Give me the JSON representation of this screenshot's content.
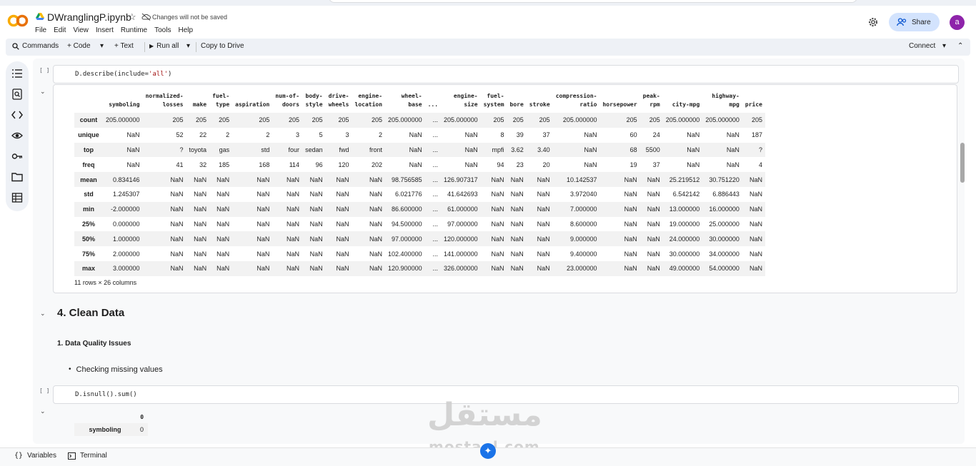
{
  "app": {
    "notebook_title": "DWranglingP.ipynb",
    "save_status": "Changes will not be saved",
    "menu": [
      "File",
      "Edit",
      "View",
      "Insert",
      "Runtime",
      "Tools",
      "Help"
    ],
    "share_label": "Share",
    "avatar_letter": "a",
    "accent_color": "#d3e3fd"
  },
  "toolbar": {
    "commands": "Commands",
    "code": "+ Code",
    "text": "+ Text",
    "run_all": "Run all",
    "copy_to_drive": "Copy to Drive",
    "connect": "Connect"
  },
  "cell1": {
    "bracket": "[ ]",
    "code_prefix": "D.describe(include=",
    "code_string": "'all'",
    "code_suffix": ")"
  },
  "describe_table": {
    "columns": [
      [
        "symboling"
      ],
      [
        "normalized-",
        "losses"
      ],
      [
        "make"
      ],
      [
        "fuel-",
        "type"
      ],
      [
        "aspiration"
      ],
      [
        "num-of-",
        "doors"
      ],
      [
        "body-",
        "style"
      ],
      [
        "drive-",
        "wheels"
      ],
      [
        "engine-",
        "location"
      ],
      [
        "wheel-",
        "base"
      ],
      [
        "..."
      ],
      [
        "engine-",
        "size"
      ],
      [
        "fuel-",
        "system"
      ],
      [
        "bore"
      ],
      [
        "stroke"
      ],
      [
        "compression-",
        "ratio"
      ],
      [
        "horsepower"
      ],
      [
        "peak-",
        "rpm"
      ],
      [
        "city-mpg"
      ],
      [
        "highway-",
        "mpg"
      ],
      [
        "price"
      ]
    ],
    "rows": [
      {
        "label": "count",
        "values": [
          "205.000000",
          "205",
          "205",
          "205",
          "205",
          "205",
          "205",
          "205",
          "205",
          "205.000000",
          "...",
          "205.000000",
          "205",
          "205",
          "205",
          "205.000000",
          "205",
          "205",
          "205.000000",
          "205.000000",
          "205"
        ]
      },
      {
        "label": "unique",
        "values": [
          "NaN",
          "52",
          "22",
          "2",
          "2",
          "3",
          "5",
          "3",
          "2",
          "NaN",
          "...",
          "NaN",
          "8",
          "39",
          "37",
          "NaN",
          "60",
          "24",
          "NaN",
          "NaN",
          "187"
        ]
      },
      {
        "label": "top",
        "values": [
          "NaN",
          "?",
          "toyota",
          "gas",
          "std",
          "four",
          "sedan",
          "fwd",
          "front",
          "NaN",
          "...",
          "NaN",
          "mpfi",
          "3.62",
          "3.40",
          "NaN",
          "68",
          "5500",
          "NaN",
          "NaN",
          "?"
        ]
      },
      {
        "label": "freq",
        "values": [
          "NaN",
          "41",
          "32",
          "185",
          "168",
          "114",
          "96",
          "120",
          "202",
          "NaN",
          "...",
          "NaN",
          "94",
          "23",
          "20",
          "NaN",
          "19",
          "37",
          "NaN",
          "NaN",
          "4"
        ]
      },
      {
        "label": "mean",
        "values": [
          "0.834146",
          "NaN",
          "NaN",
          "NaN",
          "NaN",
          "NaN",
          "NaN",
          "NaN",
          "NaN",
          "98.756585",
          "...",
          "126.907317",
          "NaN",
          "NaN",
          "NaN",
          "10.142537",
          "NaN",
          "NaN",
          "25.219512",
          "30.751220",
          "NaN"
        ]
      },
      {
        "label": "std",
        "values": [
          "1.245307",
          "NaN",
          "NaN",
          "NaN",
          "NaN",
          "NaN",
          "NaN",
          "NaN",
          "NaN",
          "6.021776",
          "...",
          "41.642693",
          "NaN",
          "NaN",
          "NaN",
          "3.972040",
          "NaN",
          "NaN",
          "6.542142",
          "6.886443",
          "NaN"
        ]
      },
      {
        "label": "min",
        "values": [
          "-2.000000",
          "NaN",
          "NaN",
          "NaN",
          "NaN",
          "NaN",
          "NaN",
          "NaN",
          "NaN",
          "86.600000",
          "...",
          "61.000000",
          "NaN",
          "NaN",
          "NaN",
          "7.000000",
          "NaN",
          "NaN",
          "13.000000",
          "16.000000",
          "NaN"
        ]
      },
      {
        "label": "25%",
        "values": [
          "0.000000",
          "NaN",
          "NaN",
          "NaN",
          "NaN",
          "NaN",
          "NaN",
          "NaN",
          "NaN",
          "94.500000",
          "...",
          "97.000000",
          "NaN",
          "NaN",
          "NaN",
          "8.600000",
          "NaN",
          "NaN",
          "19.000000",
          "25.000000",
          "NaN"
        ]
      },
      {
        "label": "50%",
        "values": [
          "1.000000",
          "NaN",
          "NaN",
          "NaN",
          "NaN",
          "NaN",
          "NaN",
          "NaN",
          "NaN",
          "97.000000",
          "...",
          "120.000000",
          "NaN",
          "NaN",
          "NaN",
          "9.000000",
          "NaN",
          "NaN",
          "24.000000",
          "30.000000",
          "NaN"
        ]
      },
      {
        "label": "75%",
        "values": [
          "2.000000",
          "NaN",
          "NaN",
          "NaN",
          "NaN",
          "NaN",
          "NaN",
          "NaN",
          "NaN",
          "102.400000",
          "...",
          "141.000000",
          "NaN",
          "NaN",
          "NaN",
          "9.400000",
          "NaN",
          "NaN",
          "30.000000",
          "34.000000",
          "NaN"
        ]
      },
      {
        "label": "max",
        "values": [
          "3.000000",
          "NaN",
          "NaN",
          "NaN",
          "NaN",
          "NaN",
          "NaN",
          "NaN",
          "NaN",
          "120.900000",
          "...",
          "326.000000",
          "NaN",
          "NaN",
          "NaN",
          "23.000000",
          "NaN",
          "NaN",
          "49.000000",
          "54.000000",
          "NaN"
        ]
      }
    ],
    "shape_note": "11 rows × 26 columns"
  },
  "section": {
    "heading": "4. Clean Data",
    "subheading": "1. Data Quality Issues",
    "bullet": "Checking missing values"
  },
  "cell2": {
    "bracket": "[ ]",
    "code": "D.isnull().sum()",
    "col_header": "0",
    "row_label": "symboling",
    "row_value": "0"
  },
  "watermark": {
    "arabic": "مستقل",
    "latin": "mostaql.com"
  },
  "statusbar": {
    "variables": "Variables",
    "terminal": "Terminal"
  }
}
